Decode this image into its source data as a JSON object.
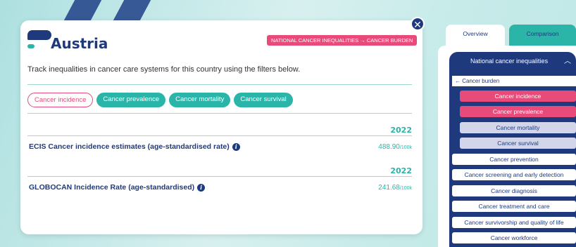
{
  "card": {
    "title": "Austria",
    "tagline": "NATIONAL CANCER INEQUALITIES → CANCER BURDEN",
    "description": "Track inequalities in cancer care systems for this country using the filters below.",
    "close_icon": "close-icon",
    "chips": [
      {
        "label": "Cancer incidence",
        "active": true
      },
      {
        "label": "Cancer prevalence",
        "active": false
      },
      {
        "label": "Cancer mortality",
        "active": false
      },
      {
        "label": "Cancer survival",
        "active": false
      }
    ],
    "metrics": [
      {
        "year": "2022",
        "label": "ECIS Cancer incidence estimates (age-standardised rate)",
        "value": "488.90",
        "unit": "/100k"
      },
      {
        "year": "2022",
        "label": "GLOBOCAN Incidence Rate (age-standardised)",
        "value": "241.68",
        "unit": "/100k"
      }
    ]
  },
  "tabs": [
    "Overview",
    "Comparison"
  ],
  "nav": {
    "header": "National cancer inequalities",
    "back": "Cancer burden",
    "sub_items": [
      "Cancer incidence",
      "Cancer prevalence",
      "Cancer mortality",
      "Cancer survival"
    ],
    "items": [
      "Cancer prevention",
      "Cancer screening and early detection",
      "Cancer diagnosis",
      "Cancer treatment and care",
      "Cancer survivorship and quality of life",
      "Cancer workforce"
    ]
  },
  "colors": {
    "navy": "#1e3a7d",
    "teal": "#2bb5a8",
    "pink": "#e84a7a",
    "lavender": "#d3d6ea"
  }
}
